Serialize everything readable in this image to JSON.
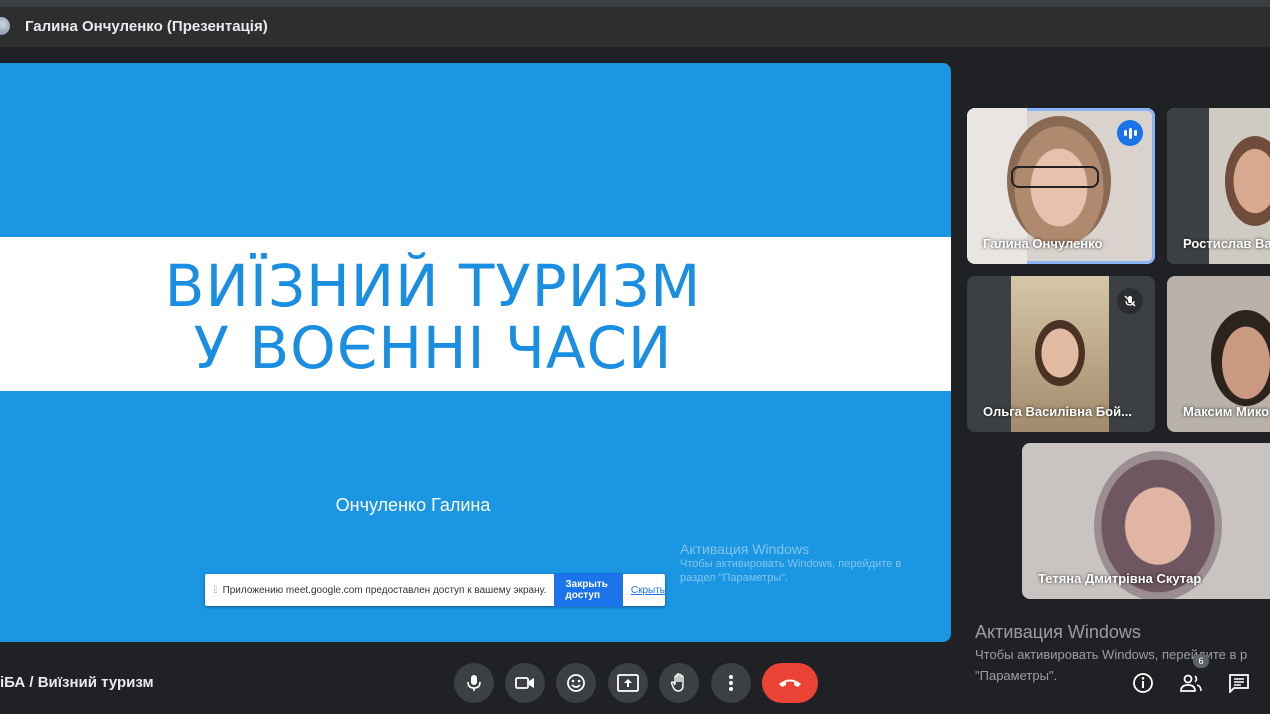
{
  "window": {
    "title": "Галина Ончуленко (Презентація)"
  },
  "slide": {
    "title_line1": "ВИЇЗНИЙ ТУРИЗМ",
    "title_line2": "У ВОЄННІ ЧАСИ",
    "author": "Ончуленко Галина",
    "bg_color": "#1a96e2"
  },
  "share_notice": {
    "message": "Приложению meet.google.com предоставлен доступ к вашему экрану.",
    "stop_label": "Закрыть доступ",
    "hide_label": "Скрыть"
  },
  "participants": [
    {
      "name": "Галина Ончуленко",
      "speaking": true
    },
    {
      "name": "Ростислав Ва"
    },
    {
      "name": "Ольга Василівна Бой...",
      "muted": true
    },
    {
      "name": "Максим Мико"
    },
    {
      "name": "Тетяна Дмитрівна Скутар"
    }
  ],
  "windows_watermark": {
    "heading": "Активация Windows",
    "line1": "Чтобы активировать Windows, перейдите в р",
    "line2": "\"Параметры\".",
    "slide_heading": "Активация Windows",
    "slide_text": "Чтобы активировать Windows, перейдите в раздел \"Параметры\"."
  },
  "meeting": {
    "title": "iБА / Виїзний туризм"
  },
  "controls": {
    "participant_count": "6"
  },
  "colors": {
    "accent": "#1a73e8",
    "end_call": "#ea4335",
    "active_border": "#8ab4f8"
  }
}
